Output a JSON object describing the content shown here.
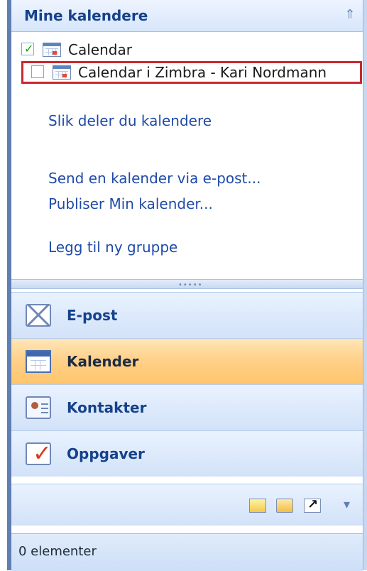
{
  "navigation_pane": {
    "section_title": "Mine kalendere",
    "calendars": [
      {
        "label": "Calendar",
        "checked": true
      },
      {
        "label": "Calendar i Zimbra - Kari Nordmann",
        "checked": false,
        "highlighted": true
      }
    ],
    "links": [
      {
        "label": "Slik deler du kalendere"
      },
      {
        "label": "Send en kalender via e-post..."
      },
      {
        "label": "Publiser Min kalender..."
      },
      {
        "label": "Legg til ny gruppe"
      }
    ],
    "nav_buttons": [
      {
        "label": "E-post",
        "icon": "mail-icon"
      },
      {
        "label": "Kalender",
        "icon": "calendar-icon",
        "active": true
      },
      {
        "label": "Kontakter",
        "icon": "contacts-icon"
      },
      {
        "label": "Oppgaver",
        "icon": "tasks-icon"
      }
    ],
    "bottom_icons": [
      "notes-icon",
      "folder-icon",
      "shortcut-icon",
      "configure-dropdown-icon"
    ]
  },
  "status_bar": {
    "text": "0 elementer"
  },
  "colors": {
    "accent_blue": "#15428b",
    "link_blue": "#1f4aa8",
    "selection_red": "#c8282f",
    "active_orange": "#ffc56c"
  }
}
